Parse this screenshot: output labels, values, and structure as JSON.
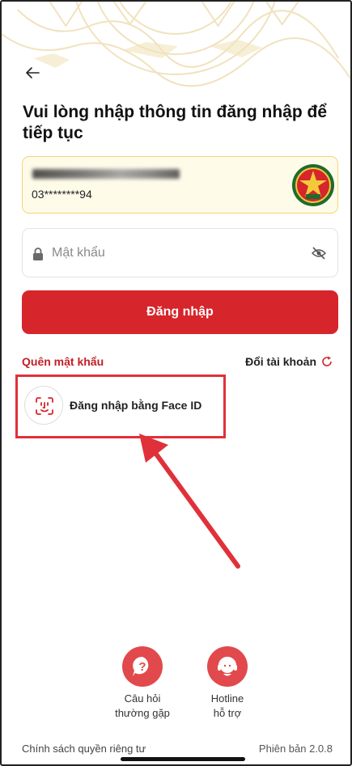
{
  "heading": "Vui lòng nhập thông tin đăng nhập để tiếp tục",
  "account": {
    "phone": "03********94",
    "logo_icon": "agency-emblem-icon"
  },
  "password": {
    "placeholder": "Mật khẩu",
    "lock_icon": "lock-icon",
    "toggle_icon": "eye-slash-icon"
  },
  "login_button": "Đăng nhập",
  "links": {
    "forgot_password": "Quên mật khẩu",
    "switch_account": "Đổi tài khoản"
  },
  "face_id": {
    "label": "Đăng nhập bằng Face ID",
    "icon": "face-id-icon"
  },
  "support": {
    "faq_label": "Câu hỏi\nthường gặp",
    "hotline_label": "Hotline\nhỗ trợ"
  },
  "footer": {
    "privacy": "Chính sách quyền riêng tư",
    "version": "Phiên bản 2.0.8"
  },
  "colors": {
    "primary_red": "#d6252b",
    "link_red": "#c11f26",
    "card_border": "#f3d57a",
    "card_bg": "#fffbe9",
    "annotation_red": "#e0313a"
  }
}
